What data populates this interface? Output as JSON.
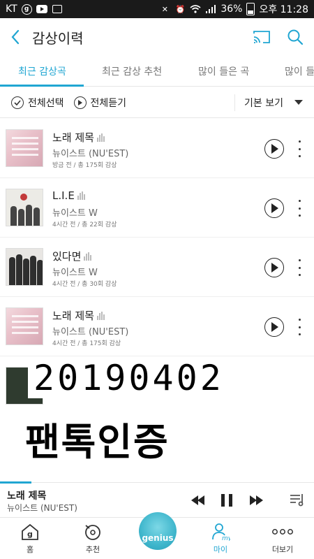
{
  "status_bar": {
    "carrier": "KT",
    "battery": "36%",
    "time": "오후 11:28"
  },
  "header": {
    "title": "감상이력"
  },
  "tabs": [
    {
      "label": "최근 감상곡",
      "active": true
    },
    {
      "label": "최근 감상 추천",
      "active": false
    },
    {
      "label": "많이 들은 곡",
      "active": false
    },
    {
      "label": "많이 들",
      "active": false
    }
  ],
  "select_bar": {
    "select_all": "전체선택",
    "play_all": "전체듣기",
    "view_mode": "기본 보기"
  },
  "songs": [
    {
      "title": "노래 제목",
      "artist": "뉴이스트 (NU'EST)",
      "meta": "방금 전 / 총 175회 감상"
    },
    {
      "title": "L.I.E",
      "artist": "뉴이스트 W",
      "meta": "4시간 전 / 총 22회 감상"
    },
    {
      "title": "있다면",
      "artist": "뉴이스트 W",
      "meta": "4시간 전 / 총 30회 감상"
    },
    {
      "title": "노래 제목",
      "artist": "뉴이스트 (NU'EST)",
      "meta": "4시간 전 / 총 175회 감상"
    }
  ],
  "overlay": {
    "date": "20190402",
    "caption": "팬톡인증"
  },
  "player": {
    "title": "노래 제목",
    "artist": "뉴이스트 (NU'EST)",
    "progress_fraction": 0.1
  },
  "bottom_nav": [
    {
      "label": "홈",
      "icon": "home-icon"
    },
    {
      "label": "추천",
      "icon": "disc-icon"
    },
    {
      "label": "genius",
      "icon": "genius-icon"
    },
    {
      "label": "마이",
      "icon": "my-icon",
      "active": true
    },
    {
      "label": "더보기",
      "icon": "more-dots-icon"
    }
  ],
  "colors": {
    "accent": "#20a6d2",
    "status_bar": "#1a1a1a"
  }
}
